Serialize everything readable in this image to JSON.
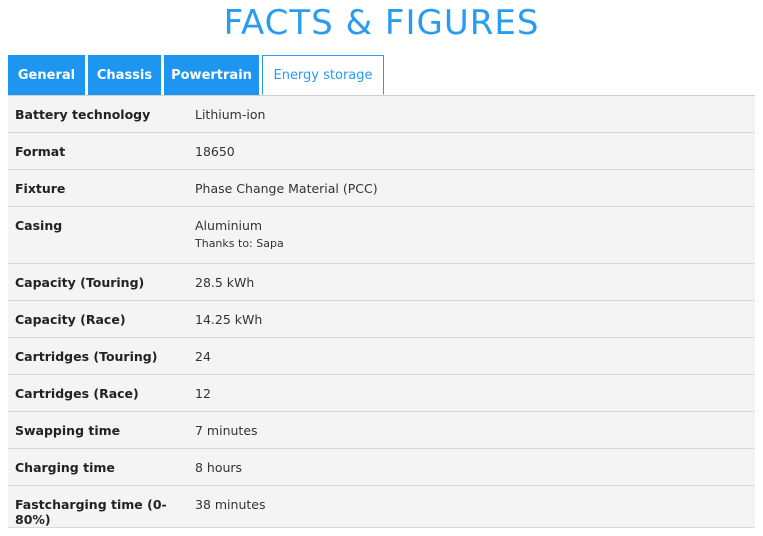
{
  "page": {
    "title": "FACTS & FIGURES"
  },
  "tabs": [
    {
      "label": "General"
    },
    {
      "label": "Chassis"
    },
    {
      "label": "Powertrain"
    },
    {
      "label": "Energy storage",
      "active": true
    }
  ],
  "rows": [
    {
      "label": "Battery technology",
      "value": "Lithium-ion"
    },
    {
      "label": "Format",
      "value": "18650"
    },
    {
      "label": "Fixture",
      "value": "Phase Change Material (PCC)"
    },
    {
      "label": "Casing",
      "value": "Aluminium",
      "note": "Thanks to: Sapa"
    },
    {
      "label": "Capacity (Touring)",
      "value": "28.5 kWh"
    },
    {
      "label": "Capacity (Race)",
      "value": "14.25 kWh"
    },
    {
      "label": "Cartridges (Touring)",
      "value": "24"
    },
    {
      "label": "Cartridges (Race)",
      "value": "12"
    },
    {
      "label": "Swapping time",
      "value": "7 minutes"
    },
    {
      "label": "Charging time",
      "value": "8 hours"
    },
    {
      "label": "Fastcharging time (0-80%)",
      "value": "38 minutes"
    }
  ],
  "colors": {
    "accent": "#1e96f0",
    "title": "#2a9cf0",
    "table_bg": "#f4f4f4"
  }
}
